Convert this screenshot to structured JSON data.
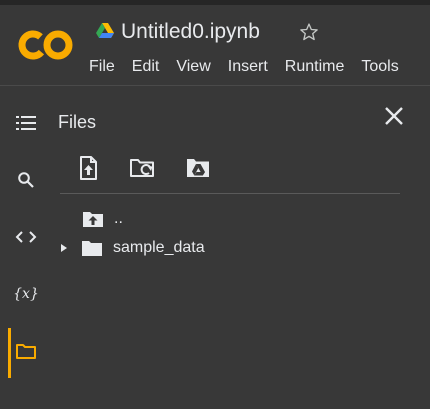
{
  "notebook": {
    "title": "Untitled0.ipynb"
  },
  "menu": [
    {
      "label": "File"
    },
    {
      "label": "Edit"
    },
    {
      "label": "View"
    },
    {
      "label": "Insert"
    },
    {
      "label": "Runtime"
    },
    {
      "label": "Tools"
    }
  ],
  "rail": {
    "items": [
      "list-icon",
      "search-icon",
      "code-icon",
      "variables-icon",
      "folder-icon"
    ],
    "variables_label": "{x}",
    "active": "folder-icon"
  },
  "files_panel": {
    "title": "Files",
    "toolbar": [
      "upload-file-icon",
      "refresh-folder-icon",
      "mount-drive-icon"
    ],
    "tree": [
      {
        "label": "..",
        "icon": "folder-up-icon",
        "expandable": false
      },
      {
        "label": "sample_data",
        "icon": "folder-icon",
        "expandable": true
      }
    ]
  },
  "colors": {
    "background": "#383838",
    "accent_orange": "#f9ab00",
    "logo_orange": "#f9ab00",
    "text": "#e8eaed"
  }
}
